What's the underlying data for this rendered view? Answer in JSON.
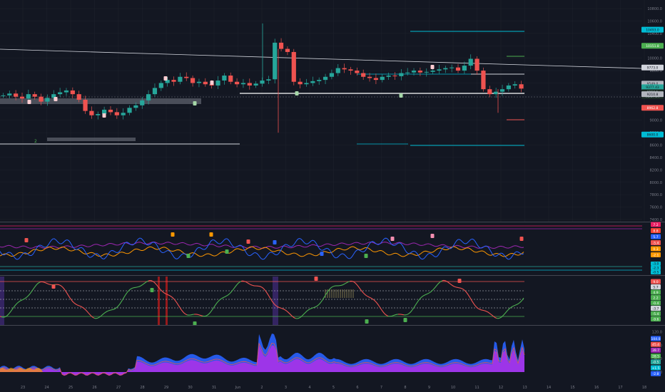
{
  "colors": {
    "background": "#131722",
    "grid": "#1e222d",
    "bull": "#26a69a",
    "bear": "#ef5350",
    "separator": "#434651",
    "accent_cyan": "#00bcd4",
    "accent_green": "#4caf50",
    "accent_purple": "#9c27b0",
    "accent_orange": "#ff9800",
    "accent_blue": "#2962ff"
  },
  "price_axis": {
    "ticks": [
      "10800.0",
      "10600.0",
      "10400.0",
      "10200.0",
      "10000.0",
      "9800.0",
      "9600.0",
      "9400.0",
      "9200.0",
      "9000.0",
      "8800.0",
      "8600.0",
      "8400.0",
      "8200.0",
      "8000.0",
      "7800.0",
      "7600.0",
      "7400.0"
    ],
    "tags": [
      {
        "text": "10493.0",
        "color": "#00bcd4",
        "text_color": "#131722",
        "value": 10460
      },
      {
        "text": "10151.8",
        "color": "#4caf50",
        "text_color": "#ffffff",
        "value": 10200
      },
      {
        "text": "9773.0",
        "color": "#d1d4dc",
        "text_color": "#131722",
        "value": 9850
      },
      {
        "text": "9549.0",
        "color": "#b2b5be",
        "text_color": "#131722",
        "value": 9590
      },
      {
        "text": "9377.43",
        "color": "#26a69a",
        "text_color": "#131722",
        "value": 9532
      },
      {
        "text": "9356.1",
        "color": "#1b2a24",
        "text_color": "#b2dfdb",
        "value": 9532
      },
      {
        "text": "01:17:30",
        "color": "#1b2a24",
        "text_color": "#b2dfdb",
        "value": 9480
      },
      {
        "text": "9210.8",
        "color": "#b2b5be",
        "text_color": "#131722",
        "value": 9420
      },
      {
        "text": "8962.8",
        "color": "#ef5350",
        "text_color": "#ffffff",
        "value": 9200
      },
      {
        "text": "8600.0",
        "color": "#00bcd4",
        "text_color": "#131722",
        "value": 8770
      }
    ]
  },
  "osc1_axis": {
    "tags": [
      {
        "text": "7.2",
        "color": "#e91e63"
      },
      {
        "text": "8.8",
        "color": "#f44336"
      },
      {
        "text": "5.7",
        "color": "#2962ff"
      },
      {
        "text": "-5.4",
        "color": "#ef5350"
      },
      {
        "text": "0.3",
        "color": "#ff9800"
      },
      {
        "text": "-2.1",
        "color": "#ff9800"
      }
    ]
  },
  "osc2_axis": {
    "tags": [
      {
        "text": "-3.0",
        "color": "#00bcd4"
      },
      {
        "text": "-2.3",
        "color": "#00bcd4"
      },
      {
        "text": "-0.5",
        "color": "#00bcd4"
      },
      {
        "text": "9.0",
        "color": "#ef5350"
      },
      {
        "text": "5.7",
        "color": "#d1d4dc"
      },
      {
        "text": "4.9",
        "color": "#4caf50"
      },
      {
        "text": "2.2",
        "color": "#4caf50"
      },
      {
        "text": "-0.4",
        "color": "#4caf50"
      },
      {
        "text": "-3.7",
        "color": "#d1d4dc"
      },
      {
        "text": "-5.4",
        "color": "#4caf50"
      },
      {
        "text": "-9.6",
        "color": "#4caf50"
      }
    ]
  },
  "osc3_axis": {
    "ticks": [
      "120.0",
      "80.0",
      "40.0",
      "0.0"
    ],
    "tags": [
      {
        "text": "104.0",
        "color": "#2962ff"
      },
      {
        "text": "45.4",
        "color": "#ef5350"
      },
      {
        "text": "39.7",
        "color": "#9c27b0"
      },
      {
        "text": "28.5",
        "color": "#4caf50"
      },
      {
        "text": "-0.5",
        "color": "#26a69a"
      },
      {
        "text": "+1.5",
        "color": "#00bcd4"
      },
      {
        "text": "-2.8",
        "color": "#2962ff"
      }
    ]
  },
  "time_axis": {
    "labels": [
      "23",
      "24",
      "25",
      "26",
      "27",
      "28",
      "29",
      "30",
      "31",
      "Jun",
      "2",
      "3",
      "4",
      "5",
      "6",
      "7",
      "8",
      "9",
      "10",
      "11",
      "12",
      "13",
      "14",
      "15",
      "16",
      "17",
      "18"
    ]
  },
  "annotations": {
    "wave_label": "2"
  },
  "chart_data": {
    "type": "candlestick",
    "x_range": [
      "23",
      "13"
    ],
    "price_ylim": [
      7400,
      10800
    ],
    "closes_approx": [
      9400,
      9430,
      9380,
      9350,
      9420,
      9380,
      9300,
      9360,
      9420,
      9450,
      9480,
      9420,
      9330,
      9150,
      9080,
      9100,
      9170,
      9130,
      9080,
      9120,
      9200,
      9240,
      9320,
      9420,
      9520,
      9600,
      9650,
      9620,
      9700,
      9680,
      9600,
      9620,
      9580,
      9560,
      9640,
      9720,
      9620,
      9580,
      9600,
      9560,
      9590,
      9640,
      9660,
      10250,
      10150,
      10100,
      9620,
      9580,
      9600,
      9630,
      9650,
      9700,
      9760,
      9840,
      9820,
      9800,
      9760,
      9700,
      9680,
      9650,
      9700,
      9720,
      9710,
      9760,
      9770,
      9800,
      9770,
      9780,
      9800,
      9820,
      9840,
      9850,
      9800,
      9880,
      9990,
      9800,
      9500,
      9420,
      9460,
      9500,
      9560,
      9580,
      9510
    ]
  }
}
